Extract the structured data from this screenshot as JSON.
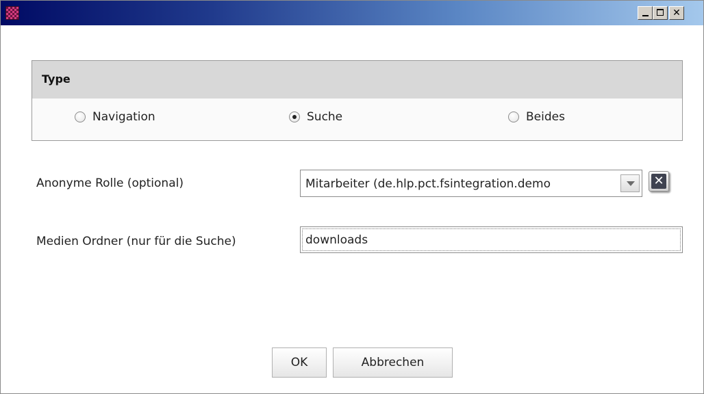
{
  "window": {
    "title": "",
    "controls": [
      "minimize",
      "maximize",
      "close"
    ]
  },
  "type_panel": {
    "heading": "Type",
    "options": [
      {
        "label": "Navigation",
        "selected": false
      },
      {
        "label": "Suche",
        "selected": true
      },
      {
        "label": "Beides",
        "selected": false
      }
    ]
  },
  "role": {
    "label": "Anonyme Rolle (optional)",
    "value": "Mitarbeiter (de.hlp.pct.fsintegration.demo"
  },
  "media": {
    "label": "Medien Ordner (nur für die Suche)",
    "value": "downloads"
  },
  "buttons": {
    "ok": "OK",
    "cancel": "Abbrechen"
  },
  "icons": {
    "app": "app-logo-icon",
    "minimize": "minimize-icon",
    "maximize": "maximize-icon",
    "close": "close-icon",
    "dropdown": "chevron-down-icon",
    "clear": "close-x-icon"
  }
}
